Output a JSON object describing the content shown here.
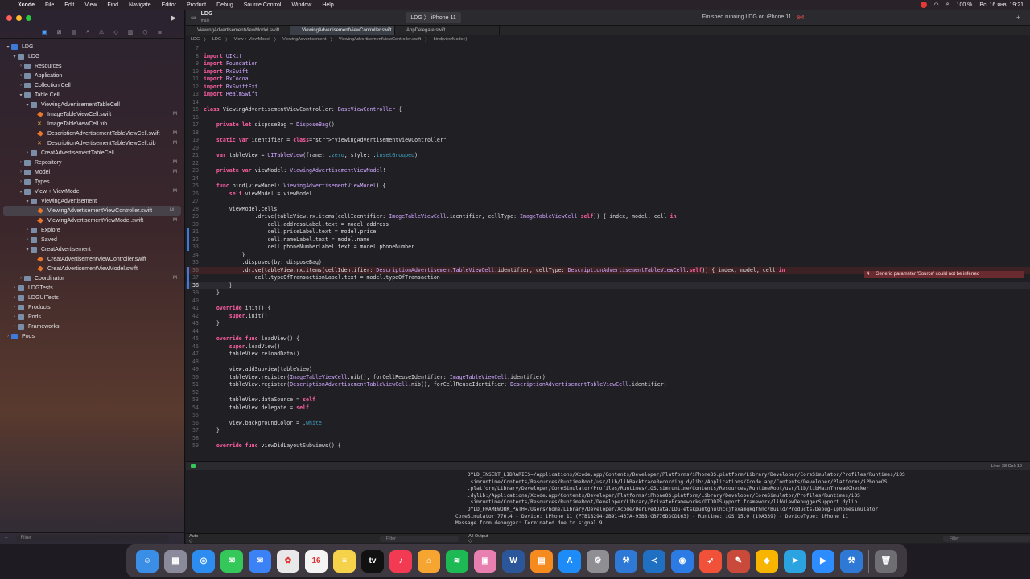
{
  "menubar": {
    "app": "Xcode",
    "items": [
      "File",
      "Edit",
      "View",
      "Find",
      "Navigate",
      "Editor",
      "Product",
      "Debug",
      "Source Control",
      "Window",
      "Help"
    ],
    "battery": "100 %",
    "clock": "Вс, 16 янв.   19:21"
  },
  "sidebar": {
    "items": [
      {
        "label": "LDG",
        "indent": 0,
        "icon": "proj",
        "tw": "▾"
      },
      {
        "label": "LDG",
        "indent": 1,
        "icon": "folder",
        "tw": "▾"
      },
      {
        "label": "Resources",
        "indent": 2,
        "icon": "folder",
        "tw": "›"
      },
      {
        "label": "Application",
        "indent": 2,
        "icon": "folder",
        "tw": "›"
      },
      {
        "label": "Collection Cell",
        "indent": 2,
        "icon": "folder",
        "tw": "›"
      },
      {
        "label": "Table Cell",
        "indent": 2,
        "icon": "folder",
        "tw": "▾"
      },
      {
        "label": "ViewingAdvertisementTableCell",
        "indent": 3,
        "icon": "folder",
        "tw": "▾"
      },
      {
        "label": "ImageTableViewCell.swift",
        "indent": 4,
        "icon": "swift",
        "tw": "",
        "badge": "M"
      },
      {
        "label": "ImageTableViewCell.xib",
        "indent": 4,
        "icon": "xib",
        "tw": ""
      },
      {
        "label": "DescriptionAdvertisementTableViewCell.swift",
        "indent": 4,
        "icon": "swift",
        "tw": "",
        "badge": "M"
      },
      {
        "label": "DescriptionAdvertisementTableViewCell.xib",
        "indent": 4,
        "icon": "xib",
        "tw": "",
        "badge": "M"
      },
      {
        "label": "CreatAdvertisementTableCell",
        "indent": 3,
        "icon": "folder",
        "tw": "›"
      },
      {
        "label": "Repository",
        "indent": 2,
        "icon": "folder",
        "tw": "›",
        "badge": "M"
      },
      {
        "label": "Model",
        "indent": 2,
        "icon": "folder",
        "tw": "›",
        "badge": "M"
      },
      {
        "label": "Types",
        "indent": 2,
        "icon": "folder",
        "tw": "›"
      },
      {
        "label": "View + ViewModel",
        "indent": 2,
        "icon": "folder",
        "tw": "▾",
        "badge": "M"
      },
      {
        "label": "ViewingAdvertisement",
        "indent": 3,
        "icon": "folder",
        "tw": "▾"
      },
      {
        "label": "ViewingAdvertisementViewController.swift",
        "indent": 4,
        "icon": "swift",
        "tw": "",
        "badge": "M",
        "selected": true
      },
      {
        "label": "ViewingAdvertisementViewModel.swift",
        "indent": 4,
        "icon": "swift",
        "tw": "",
        "badge": "M"
      },
      {
        "label": "Explore",
        "indent": 3,
        "icon": "folder",
        "tw": "›"
      },
      {
        "label": "Saved",
        "indent": 3,
        "icon": "folder",
        "tw": "›"
      },
      {
        "label": "CreatAdvertisement",
        "indent": 3,
        "icon": "folder",
        "tw": "▾"
      },
      {
        "label": "CreatAdvertisementViewController.swift",
        "indent": 4,
        "icon": "swift",
        "tw": ""
      },
      {
        "label": "CreatAdvertisementViewModel.swift",
        "indent": 4,
        "icon": "swift",
        "tw": ""
      },
      {
        "label": "Coordinator",
        "indent": 2,
        "icon": "folder",
        "tw": "›",
        "badge": "M"
      },
      {
        "label": "LDGTests",
        "indent": 1,
        "icon": "folder",
        "tw": "›"
      },
      {
        "label": "LDGUITests",
        "indent": 1,
        "icon": "folder",
        "tw": "›"
      },
      {
        "label": "Products",
        "indent": 1,
        "icon": "folder",
        "tw": "›"
      },
      {
        "label": "Pods",
        "indent": 1,
        "icon": "folder",
        "tw": "›"
      },
      {
        "label": "Frameworks",
        "indent": 1,
        "icon": "folder",
        "tw": "›"
      },
      {
        "label": "Pods",
        "indent": 0,
        "icon": "proj",
        "tw": "›"
      }
    ],
    "filter_placeholder": "Filter"
  },
  "toolbar": {
    "project": "LDG",
    "branch": "main",
    "scheme": "LDG",
    "device": "iPhone 11",
    "status": "Finished running LDG on iPhone 11",
    "warnings": "4"
  },
  "tabs": [
    "ViewingAdvertisementViewModel.swift",
    "ViewingAdvertisementViewController.swift",
    "AppDelegate.swift"
  ],
  "breadcrumbs": [
    "LDG",
    "LDG",
    "View + ViewModel",
    "ViewingAdvertisement",
    "ViewingAdvertisementViewController.swift",
    "bind(viewModel:)"
  ],
  "code": [
    {
      "n": "7",
      "t": ""
    },
    {
      "n": "8",
      "t": "import UIKit"
    },
    {
      "n": "9",
      "t": "import Foundation"
    },
    {
      "n": "10",
      "t": "import RxSwift"
    },
    {
      "n": "11",
      "t": "import RxCocoa"
    },
    {
      "n": "12",
      "t": "import RxSwiftExt"
    },
    {
      "n": "13",
      "t": "import RealmSwift"
    },
    {
      "n": "14",
      "t": ""
    },
    {
      "n": "15",
      "t": "class ViewingAdvertisementViewController: BaseViewController {"
    },
    {
      "n": "16",
      "t": ""
    },
    {
      "n": "17",
      "t": "    private let disposeBag = DisposeBag()"
    },
    {
      "n": "18",
      "t": ""
    },
    {
      "n": "19",
      "t": "    static var identifier = \"ViewingAdvertisementViewController\""
    },
    {
      "n": "20",
      "t": ""
    },
    {
      "n": "21",
      "t": "    var tableView = UITableView(frame: .zero, style: .insetGrouped)"
    },
    {
      "n": "22",
      "t": ""
    },
    {
      "n": "23",
      "t": "    private var viewModel: ViewingAdvertisementViewModel!"
    },
    {
      "n": "24",
      "t": ""
    },
    {
      "n": "25",
      "t": "    func bind(viewModel: ViewingAdvertisementViewModel) {"
    },
    {
      "n": "26",
      "t": "        self.viewModel = viewModel"
    },
    {
      "n": "27",
      "t": ""
    },
    {
      "n": "28",
      "t": "        viewModel.cells"
    },
    {
      "n": "29",
      "t": "                .drive(tableView.rx.items(cellIdentifier: ImageTableViewCell.identifier, cellType: ImageTableViewCell.self)) { index, model, cell in"
    },
    {
      "n": "30",
      "t": "                    cell.addressLabel.text = model.address"
    },
    {
      "n": "31",
      "t": "                    cell.priceLabel.text = model.price"
    },
    {
      "n": "32",
      "t": "                    cell.nameLabel.text = model.name"
    },
    {
      "n": "33",
      "t": "                    cell.phoneNumberLabel.text = model.phoneNumber"
    },
    {
      "n": "34",
      "t": "            }"
    },
    {
      "n": "35",
      "t": "            .disposed(by: disposeBag)"
    },
    {
      "n": "36",
      "t": "            .drive(tableView.rx.items(cellIdentifier: DescriptionAdvertisementTableViewCell.identifier, cellType: DescriptionAdvertisementTableViewCell.self)) { index, model, cell in"
    },
    {
      "n": "37",
      "t": "                cell.typeOfTransactionLabel.text = model.typeOfTransaction"
    },
    {
      "n": "38",
      "t": "        }"
    },
    {
      "n": "39",
      "t": "    }"
    },
    {
      "n": "40",
      "t": ""
    },
    {
      "n": "41",
      "t": "    override init() {"
    },
    {
      "n": "42",
      "t": "        super.init()"
    },
    {
      "n": "43",
      "t": "    }"
    },
    {
      "n": "44",
      "t": ""
    },
    {
      "n": "45",
      "t": "    override func loadView() {"
    },
    {
      "n": "46",
      "t": "        super.loadView()"
    },
    {
      "n": "47",
      "t": "        tableView.reloadData()"
    },
    {
      "n": "48",
      "t": ""
    },
    {
      "n": "49",
      "t": "        view.addSubview(tableView)"
    },
    {
      "n": "50",
      "t": "        tableView.register(ImageTableViewCell.nib(), forCellReuseIdentifier: ImageTableViewCell.identifier)"
    },
    {
      "n": "51",
      "t": "        tableView.register(DescriptionAdvertisementTableViewCell.nib(), forCellReuseIdentifier: DescriptionAdvertisementTableViewCell.identifier)"
    },
    {
      "n": "52",
      "t": ""
    },
    {
      "n": "53",
      "t": "        tableView.dataSource = self"
    },
    {
      "n": "54",
      "t": "        tableView.delegate = self"
    },
    {
      "n": "55",
      "t": ""
    },
    {
      "n": "56",
      "t": "        view.backgroundColor = .white"
    },
    {
      "n": "57",
      "t": "    }"
    },
    {
      "n": "58",
      "t": ""
    },
    {
      "n": "59",
      "t": "    override func viewDidLayoutSubviews() {"
    }
  ],
  "error": {
    "count": "4",
    "message": "Generic parameter 'Source' could not be inferred"
  },
  "debug": {
    "position": "Line: 38  Col: 10"
  },
  "console": [
    "    DYLD_INSERT_LIBRARIES=/Applications/Xcode.app/Contents/Developer/Platforms/iPhoneOS.platform/Library/Developer/CoreSimulator/Profiles/Runtimes/iOS",
    "    .simruntime/Contents/Resources/RuntimeRoot/usr/lib/libBacktraceRecording.dylib:/Applications/Xcode.app/Contents/Developer/Platforms/iPhoneOS",
    "    .platform/Library/Developer/CoreSimulator/Profiles/Runtimes/iOS.simruntime/Contents/Resources/RuntimeRoot/usr/lib/libMainThreadChecker",
    "    .dylib:/Applications/Xcode.app/Contents/Developer/Platforms/iPhoneOS.platform/Library/Developer/CoreSimulator/Profiles/Runtimes/iOS",
    "    .simruntime/Contents/Resources/RuntimeRoot/Developer/Library/PrivateFrameworks/DTDDISupport.framework/libViewDebuggerSupport.dylib",
    "    DYLD_FRAMEWORK_PATH=/Users/home/Library/Developer/Xcode/DerivedData/LDG-etskpumtgnulhccjfexamqkqfhnc/Build/Products/Debug-iphonesimulator",
    "CoreSimulator 776.4 - Device: iPhone 11 (F7B18294-2B91-437A-93BB-CB776D3CD163) - Runtime: iOS 15.0 (19A339) - DeviceType: iPhone 11",
    "Message from debugger: Terminated due to signal 9"
  ],
  "filterbar": {
    "auto": "Auto ◇",
    "filter1": "Filter",
    "output": "All Output ◇",
    "filter2": "Filter"
  },
  "dock": [
    {
      "name": "finder-icon",
      "color": "#3a8ee6",
      "glyph": "☺"
    },
    {
      "name": "launchpad-icon",
      "color": "#8a8a9a",
      "glyph": "▦"
    },
    {
      "name": "safari-icon",
      "color": "#2d8cf0",
      "glyph": "◎"
    },
    {
      "name": "messages-icon",
      "color": "#34c759",
      "glyph": "✉"
    },
    {
      "name": "mail-icon",
      "color": "#3b82f6",
      "glyph": "✉"
    },
    {
      "name": "photos-icon",
      "color": "#e8e8e8",
      "glyph": "✿"
    },
    {
      "name": "calendar-icon",
      "color": "#f4f4f4",
      "glyph": "16"
    },
    {
      "name": "notes-icon",
      "color": "#f6d24a",
      "glyph": "≡"
    },
    {
      "name": "tv-icon",
      "color": "#111111",
      "glyph": "tv"
    },
    {
      "name": "music-icon",
      "color": "#f23a52",
      "glyph": "♪"
    },
    {
      "name": "home-icon",
      "color": "#f7a531",
      "glyph": "⌂"
    },
    {
      "name": "spotify-icon",
      "color": "#1db954",
      "glyph": "≋"
    },
    {
      "name": "cleanmymac-icon",
      "color": "#e77fb0",
      "glyph": "▣"
    },
    {
      "name": "word-icon",
      "color": "#2b579a",
      "glyph": "W"
    },
    {
      "name": "books-icon",
      "color": "#f58a1f",
      "glyph": "▤"
    },
    {
      "name": "appstore-icon",
      "color": "#1d8cf8",
      "glyph": "A"
    },
    {
      "name": "settings-icon",
      "color": "#8e8e93",
      "glyph": "⚙"
    },
    {
      "name": "xcode-icon",
      "color": "#2f79d6",
      "glyph": "⚒"
    },
    {
      "name": "vscode-icon",
      "color": "#1f6fc2",
      "glyph": "≺"
    },
    {
      "name": "maps-icon",
      "color": "#2c7be5",
      "glyph": "◉"
    },
    {
      "name": "swift-icon",
      "color": "#f05138",
      "glyph": "➶"
    },
    {
      "name": "ipad-icon",
      "color": "#c9493a",
      "glyph": "✎"
    },
    {
      "name": "sketch-icon",
      "color": "#f7b500",
      "glyph": "◆"
    },
    {
      "name": "telegram-icon",
      "color": "#2aa3e0",
      "glyph": "➤"
    },
    {
      "name": "zoom-icon",
      "color": "#2d8cff",
      "glyph": "▶"
    },
    {
      "name": "simulator-icon",
      "color": "#2f79d6",
      "glyph": "⚒"
    },
    {
      "name": "trash-icon",
      "color": "#6e6e73",
      "glyph": "🗑"
    }
  ]
}
